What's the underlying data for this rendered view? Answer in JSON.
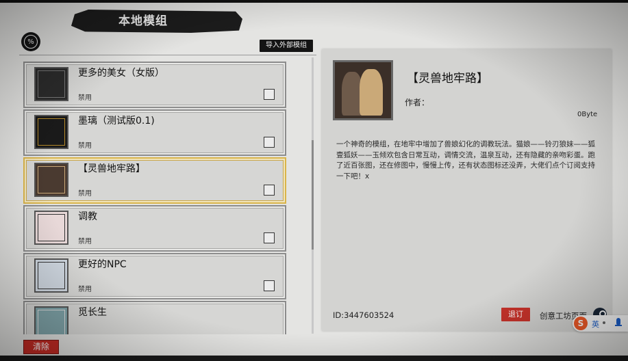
{
  "header": {
    "title": "本地模组",
    "import_button": "导入外部模组"
  },
  "sort_icon": {
    "glyph": "%"
  },
  "mods": [
    {
      "name": "更多的美女（女版）",
      "status": "禁用",
      "selected": false
    },
    {
      "name": "墨璃（测试版0.1)",
      "status": "禁用",
      "selected": false
    },
    {
      "name": "【灵兽地牢路】",
      "status": "禁用",
      "selected": true
    },
    {
      "name": "调教",
      "status": "禁用",
      "selected": false
    },
    {
      "name": "更好的NPC",
      "status": "禁用",
      "selected": false
    },
    {
      "name": "觅长生",
      "status": "",
      "selected": false
    }
  ],
  "detail": {
    "title": "【灵兽地牢路】",
    "author_label": "作者：",
    "size": "0Byte",
    "description": "一个神奇的模组，在地牢中增加了兽娘幻化的调教玩法。猫娘——铃刃狼妹——狐壹狐妖——玉倾欢包含日常互动，调情交流，温泉互动，还有隐藏的亲吻彩蛋。跑了近百张图，还在修图中，慢慢上传，还有状态图标还没弄，大佬们点个订阅支持一下吧！x",
    "id": "ID:3447603524",
    "unsubscribe_button": "退订",
    "workshop_link": "创意工坊页面"
  },
  "footer": {
    "delete_button": "清除"
  },
  "ime": {
    "logo": "S",
    "lang": "英"
  },
  "colors": {
    "selected_border": "#d9b44a",
    "danger": "#c62b24",
    "panel_bg": "#d3d3d1"
  }
}
